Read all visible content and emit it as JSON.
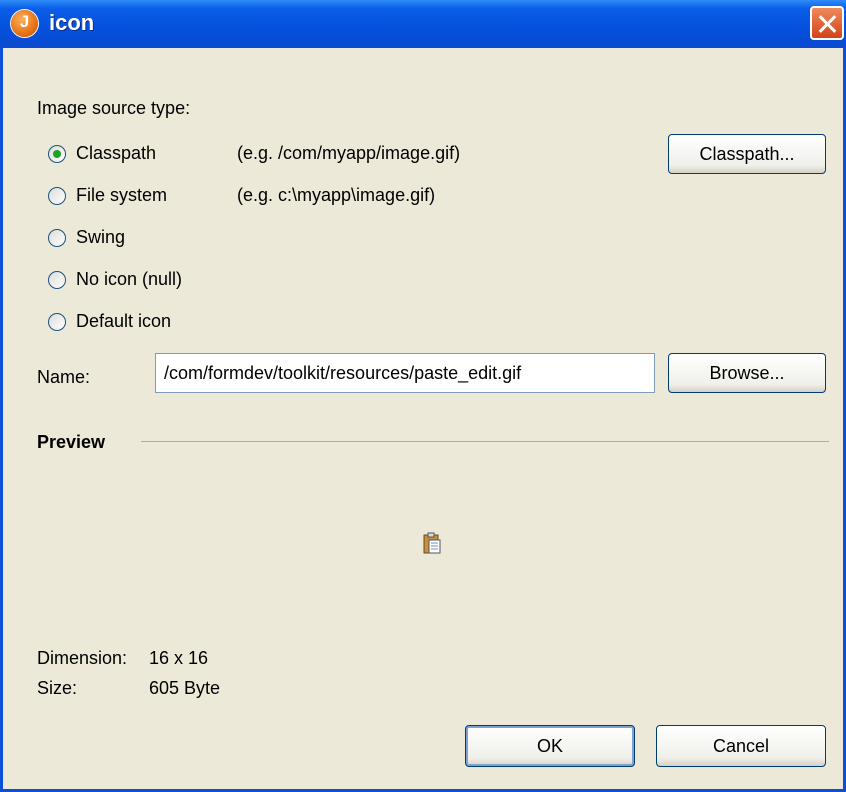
{
  "window": {
    "title": "icon",
    "app_icon_letter": "J"
  },
  "source_type": {
    "heading": "Image source type:",
    "options": [
      {
        "label": "Classpath",
        "hint": "(e.g. /com/myapp/image.gif)",
        "selected": true
      },
      {
        "label": "File system",
        "hint": "(e.g. c:\\myapp\\image.gif)",
        "selected": false
      },
      {
        "label": "Swing",
        "hint": "",
        "selected": false
      },
      {
        "label": "No icon (null)",
        "hint": "",
        "selected": false
      },
      {
        "label": "Default icon",
        "hint": "",
        "selected": false
      }
    ],
    "classpath_button": "Classpath..."
  },
  "name": {
    "label": "Name:",
    "value": "/com/formdev/toolkit/resources/paste_edit.gif",
    "browse_button": "Browse..."
  },
  "preview": {
    "heading": "Preview",
    "icon": "paste-icon"
  },
  "info": {
    "dimension_label": "Dimension:",
    "dimension_value": "16 x 16",
    "size_label": "Size:",
    "size_value": "605 Byte"
  },
  "buttons": {
    "ok": "OK",
    "cancel": "Cancel"
  },
  "colors": {
    "titlebar": "#0a5ee8",
    "dialog_bg": "#ece9d8",
    "radio_dot": "#21a121",
    "close": "#d4431a"
  }
}
